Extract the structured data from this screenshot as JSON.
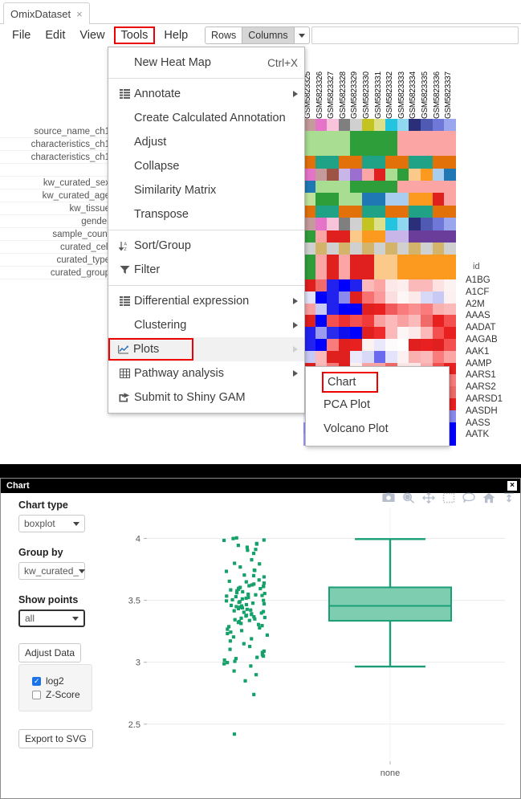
{
  "window": {
    "tab_title": "OmixDataset",
    "tab_close": "×"
  },
  "menubar": {
    "items": [
      {
        "label": "File",
        "highlighted": false
      },
      {
        "label": "Edit",
        "highlighted": false
      },
      {
        "label": "View",
        "highlighted": false
      },
      {
        "label": "Tools",
        "highlighted": true
      },
      {
        "label": "Help",
        "highlighted": false
      }
    ],
    "rows_label": "Rows",
    "columns_label": "Columns",
    "search_value": ""
  },
  "tools_menu": {
    "groups": [
      {
        "items": [
          {
            "label": "New Heat Map",
            "shortcut": "Ctrl+X",
            "icon": "",
            "submenu": false
          }
        ]
      },
      {
        "items": [
          {
            "label": "Annotate",
            "shortcut": "",
            "icon": "list-icon",
            "submenu": true
          },
          {
            "label": "Create Calculated Annotation",
            "shortcut": "",
            "icon": "",
            "submenu": false
          },
          {
            "label": "Adjust",
            "shortcut": "",
            "icon": "",
            "submenu": false
          },
          {
            "label": "Collapse",
            "shortcut": "",
            "icon": "",
            "submenu": false
          },
          {
            "label": "Similarity Matrix",
            "shortcut": "",
            "icon": "",
            "submenu": false
          },
          {
            "label": "Transpose",
            "shortcut": "",
            "icon": "",
            "submenu": false
          }
        ]
      },
      {
        "items": [
          {
            "label": "Sort/Group",
            "shortcut": "",
            "icon": "sort-az-icon",
            "submenu": false
          },
          {
            "label": "Filter",
            "shortcut": "",
            "icon": "funnel-icon",
            "submenu": false
          }
        ]
      },
      {
        "items": [
          {
            "label": "Differential expression",
            "shortcut": "",
            "icon": "list-icon",
            "submenu": true
          },
          {
            "label": "Clustering",
            "shortcut": "",
            "icon": "",
            "submenu": true
          },
          {
            "label": "Plots",
            "shortcut": "",
            "icon": "chart-line-icon",
            "submenu": true,
            "highlighted": true
          },
          {
            "label": "Pathway analysis",
            "shortcut": "",
            "icon": "table-icon",
            "submenu": true
          },
          {
            "label": "Submit to Shiny GAM",
            "shortcut": "",
            "icon": "share-icon",
            "submenu": false
          }
        ]
      }
    ]
  },
  "plots_submenu": {
    "items": [
      {
        "label": "Chart",
        "highlighted": true
      },
      {
        "label": "PCA Plot",
        "highlighted": false
      },
      {
        "label": "Volcano Plot",
        "highlighted": false
      }
    ]
  },
  "heatmap": {
    "row_labels": [
      "source_name_ch1",
      "characteristics_ch1",
      "characteristics_ch1",
      "",
      "kw_curated_sex",
      "kw_curated_age",
      "kw_tissue",
      "gender",
      "sample_count",
      "curated_cell",
      "curated_type",
      "curated_group"
    ],
    "column_headers": [
      "GSM5823325",
      "GSM5823326",
      "GSM5823327",
      "GSM5823328",
      "GSM5823329",
      "GSM5823330",
      "GSM5823331",
      "GSM5823332",
      "GSM5823333",
      "GSM5823334",
      "GSM5823335",
      "GSM5823336",
      "GSM5823337"
    ],
    "id_header": "id",
    "gene_ids": [
      "A1BG",
      "A1CF",
      "A2M",
      "AAAS",
      "AADAT",
      "AAGAB",
      "AAK1",
      "AAMP",
      "AARS1",
      "AARS2",
      "AARSD1",
      "AASDH",
      "AASS",
      "AATK"
    ],
    "annotation_rows": [
      [
        "#c49a9a",
        "#e573c7",
        "#f9c4db",
        "#7f7f7f",
        "#d0d0d0",
        "#c3c421",
        "#dde08a",
        "#22c4e0",
        "#8fd8ef",
        "#2b2f7a",
        "#4f5bb3",
        "#6f78d8",
        "#9aa6ee"
      ],
      [
        "#a8dd92",
        "#a8dd92",
        "#a8dd92",
        "#a8dd92",
        "#2e9e3a",
        "#2e9e3a",
        "#2e9e3a",
        "#2e9e3a",
        "#fba5a5",
        "#fba5a5",
        "#fba5a5",
        "#fba5a5",
        "#fba5a5"
      ],
      [
        "#a8dd92",
        "#a8dd92",
        "#a8dd92",
        "#a8dd92",
        "#2e9e3a",
        "#2e9e3a",
        "#2e9e3a",
        "#2e9e3a",
        "#fba5a5",
        "#fba5a5",
        "#fba5a5",
        "#fba5a5",
        "#fba5a5"
      ],
      [
        "#e2710a",
        "#20a286",
        "#20a286",
        "#e2710a",
        "#e2710a",
        "#20a286",
        "#20a286",
        "#e2710a",
        "#e2710a",
        "#20a286",
        "#20a286",
        "#e2710a",
        "#e2710a"
      ],
      [
        "#e573c7",
        "#c49a9a",
        "#9d5444",
        "#c9b6e8",
        "#9b6fcf",
        "#fba5a5",
        "#e01f1f",
        "#a8dd92",
        "#2e9e3a",
        "#fbc98a",
        "#fb9a1e",
        "#a9cdef",
        "#1f78b4"
      ],
      [
        "#1f78b4",
        "#a8dd92",
        "#a8dd92",
        "#a8dd92",
        "#2e9e3a",
        "#2e9e3a",
        "#2e9e3a",
        "#2e9e3a",
        "#fba5a5",
        "#fba5a5",
        "#fba5a5",
        "#fba5a5",
        "#fba5a5"
      ],
      [
        "#bfe39d",
        "#2e9e3a",
        "#2e9e3a",
        "#a8dd92",
        "#a8dd92",
        "#1f78b4",
        "#1f78b4",
        "#a9cdef",
        "#a9cdef",
        "#fb9a1e",
        "#fb9a1e",
        "#e01f1f",
        "#fba5a5"
      ],
      [
        "#e2710a",
        "#20a286",
        "#20a286",
        "#e2710a",
        "#e2710a",
        "#20a286",
        "#20a286",
        "#e2710a",
        "#e2710a",
        "#20a286",
        "#20a286",
        "#e2710a",
        "#e2710a"
      ],
      [
        "#c49a9a",
        "#e573c7",
        "#f9c4db",
        "#7f7f7f",
        "#d0d0d0",
        "#c3c421",
        "#dde08a",
        "#22c4e0",
        "#8fd8ef",
        "#2b2f7a",
        "#4f5bb3",
        "#6f78d8",
        "#9aa6ee"
      ],
      [
        "#2e9e3a",
        "#fba5a5",
        "#e01f1f",
        "#e01f1f",
        "#fbc98a",
        "#fb9a1e",
        "#fb9a1e",
        "#c9b6e8",
        "#c9b6e8",
        "#6a3d9a",
        "#6a3d9a",
        "#6a3d9a",
        "#6a3d9a"
      ],
      [
        "#d0d0d0",
        "#d4b46a",
        "#d0d0d0",
        "#d4b46a",
        "#d0d0d0",
        "#d4b46a",
        "#d0d0d0",
        "#d4b46a",
        "#d0d0d0",
        "#d4b46a",
        "#d0d0d0",
        "#d4b46a",
        "#d0d0d0"
      ],
      [
        "#2e9e3a",
        "#fba5a5",
        "#e01f1f",
        "#fba5a5",
        "#e01f1f",
        "#e01f1f",
        "#fbc98a",
        "#fbc98a",
        "#fb9a1e",
        "#fb9a1e",
        "#fb9a1e",
        "#fb9a1e",
        "#fb9a1e"
      ],
      [
        "#2e9e3a",
        "#fba5a5",
        "#e01f1f",
        "#fba5a5",
        "#e01f1f",
        "#e01f1f",
        "#fbc98a",
        "#fbc98a",
        "#fb9a1e",
        "#fb9a1e",
        "#fb9a1e",
        "#fb9a1e",
        "#fb9a1e"
      ]
    ],
    "expression_rows": [
      [
        "#e01f1f",
        "#f06a6a",
        "#2222ee",
        "#0000ff",
        "#2222ee",
        "#fbb9b9",
        "#fba5a5",
        "#fde8e8",
        "#fdeeee",
        "#fbb9b9",
        "#fbb9b9",
        "#fde2e2",
        "#fdf2f2"
      ],
      [
        "#e3e3fb",
        "#0000ff",
        "#2222ee",
        "#8a8aee",
        "#e01f1f",
        "#f97070",
        "#fb9a9a",
        "#fcdede",
        "#fdf6f6",
        "#fceaea",
        "#d8d8f7",
        "#c9c9f5",
        "#fdf0f0"
      ],
      [
        "#f9a0a0",
        "#c9c9f5",
        "#2222ee",
        "#0000ff",
        "#0000ff",
        "#e01f1f",
        "#e82020",
        "#f05a5a",
        "#f97b7b",
        "#f98f8f",
        "#f97b7b",
        "#fbb0b0",
        "#fbb9b9"
      ],
      [
        "#e01f1f",
        "#0000ff",
        "#f45050",
        "#ef3030",
        "#f45050",
        "#f13b3b",
        "#f9a0a0",
        "#fbb9b9",
        "#f9a0a0",
        "#fbb9b9",
        "#f06a6a",
        "#e82020",
        "#f45050"
      ],
      [
        "#2222ee",
        "#9a9af0",
        "#2b2bee",
        "#1010ee",
        "#0000ff",
        "#e01f1f",
        "#ee2a2a",
        "#fbb9b9",
        "#fdf6f6",
        "#fceaea",
        "#fbb9b9",
        "#f45050",
        "#e82020"
      ],
      [
        "#2222ee",
        "#0000ff",
        "#f97b7b",
        "#e01f1f",
        "#e82020",
        "#fdf2f2",
        "#e9e9fb",
        "#fdfbfb",
        "#ffffff",
        "#e01f1f",
        "#e82020",
        "#e01f1f",
        "#f45050"
      ],
      [
        "#c9c9f5",
        "#fbb9b9",
        "#e01f1f",
        "#e01f1f",
        "#e9e9fb",
        "#d8d8f7",
        "#6a6aef",
        "#e3e3fb",
        "#fdf0f0",
        "#fbb0b0",
        "#fbb9b9",
        "#f97b7b",
        "#fba5a5"
      ],
      [
        "#e01f1f",
        "#fbb9b9",
        "#f97b7b",
        "#e01f1f",
        "#fdf2f2",
        "#fba5a5",
        "#fba5a5",
        "#f06a6a",
        "#fde8e8",
        "#fceaea",
        "#fbb0b0",
        "#f45050",
        "#e82020"
      ],
      [
        "#8a8aee",
        "#c9c9f5",
        "#e3e3fb",
        "#f9a0a0",
        "#fbb9b9",
        "#e01f1f",
        "#f45050",
        "#fbb0b0",
        "#fdeeee",
        "#d8d8f7",
        "#c9c9f5",
        "#fba5a5",
        "#f97b7b"
      ],
      [
        "#b5b5f2",
        "#9a9af0",
        "#e9e9fb",
        "#fdf2f2",
        "#e01f1f",
        "#f45050",
        "#fba5a5",
        "#fdf0f0",
        "#c9c9f5",
        "#b5b5f2",
        "#e3e3fb",
        "#fbb9b9",
        "#f06a6a"
      ],
      [
        "#6a6aef",
        "#2222ee",
        "#8a8aee",
        "#fbb9b9",
        "#e01f1f",
        "#f97b7b",
        "#fdeeee",
        "#fceaea",
        "#fdf6f6",
        "#e3e3fb",
        "#fba5a5",
        "#f45050",
        "#e82020"
      ],
      [
        "#e3e3fb",
        "#fbb0b0",
        "#f06a6a",
        "#e01f1f",
        "#e82020",
        "#f9a0a0",
        "#fde8e8",
        "#ffffff",
        "#fdf6f6",
        "#c9c9f5",
        "#b5b5f2",
        "#9a9af0",
        "#8a8aee"
      ],
      [
        "#8a8aee",
        "#6a6aef",
        "#e3e3fb",
        "#fdf2f2",
        "#fba5a5",
        "#e01f1f",
        "#f45050",
        "#fbb9b9",
        "#fdeeee",
        "#fceaea",
        "#e9e9fb",
        "#2222ee",
        "#0000ff"
      ],
      [
        "#9a9af0",
        "#b5b5f2",
        "#e9e9fb",
        "#fceaea",
        "#fbb0b0",
        "#e01f1f",
        "#f97b7b",
        "#fba5a5",
        "#c9c9f5",
        "#d8d8f7",
        "#e3e3fb",
        "#2222ee",
        "#0000ff"
      ]
    ]
  },
  "chart_panel": {
    "title": "Chart",
    "close_label": "×",
    "controls": {
      "chart_type_label": "Chart type",
      "chart_type_value": "boxplot",
      "group_by_label": "Group by",
      "group_by_value": "kw_curated_",
      "show_points_label": "Show points",
      "show_points_value": "all",
      "adjust_data_label": "Adjust Data",
      "checkboxes": [
        {
          "label": "log2",
          "checked": true
        },
        {
          "label": "Z-Score",
          "checked": false
        }
      ],
      "export_label": "Export to SVG"
    },
    "modebar": [
      "camera-icon",
      "zoom-icon",
      "pan-icon",
      "box-select-icon",
      "lasso-select-icon",
      "home-icon",
      "autoscale-icon"
    ]
  },
  "chart_data": {
    "type": "box",
    "title": "",
    "xlabel": "",
    "ylabel": "",
    "categories": [
      "none"
    ],
    "ylim": [
      2.2,
      4.25
    ],
    "yticks": [
      2.5,
      3,
      3.5,
      4
    ],
    "ytick_labels": [
      "2.5",
      "3",
      "3.5",
      "4"
    ],
    "grid": true,
    "legend": "none",
    "box_color": "#7fcdb0",
    "box_line_color": "#1b9e77",
    "point_color": "#16a06a",
    "series": [
      {
        "name": "none",
        "box": {
          "lower_whisker": 2.965,
          "q1": 3.335,
          "median": 3.455,
          "q3": 3.605,
          "upper_whisker": 3.995
        },
        "points": [
          3.985,
          3.988,
          4.005,
          4.0,
          3.912,
          3.93,
          3.945,
          3.96,
          3.955,
          3.905,
          3.88,
          3.828,
          3.795,
          3.8,
          3.77,
          3.742,
          3.745,
          3.735,
          3.7,
          3.705,
          3.69,
          3.665,
          3.655,
          3.65,
          3.64,
          3.632,
          3.625,
          3.618,
          3.615,
          3.612,
          3.605,
          3.598,
          3.595,
          3.59,
          3.585,
          3.578,
          3.57,
          3.562,
          3.556,
          3.55,
          3.545,
          3.54,
          3.535,
          3.53,
          3.524,
          3.518,
          3.512,
          3.505,
          3.5,
          3.496,
          3.49,
          3.484,
          3.478,
          3.472,
          3.466,
          3.46,
          3.455,
          3.45,
          3.445,
          3.44,
          3.434,
          3.428,
          3.422,
          3.416,
          3.41,
          3.404,
          3.398,
          3.392,
          3.386,
          3.38,
          3.374,
          3.368,
          3.362,
          3.356,
          3.35,
          3.344,
          3.338,
          3.33,
          3.322,
          3.314,
          3.305,
          3.296,
          3.288,
          3.278,
          3.268,
          3.256,
          3.244,
          3.232,
          3.22,
          3.205,
          3.19,
          3.172,
          3.15,
          3.128,
          3.105,
          3.09,
          3.08,
          3.07,
          3.06,
          3.05,
          3.04,
          3.03,
          3.018,
          3.008,
          2.998,
          2.988,
          2.97,
          2.93,
          2.9,
          2.85,
          2.74,
          2.42
        ]
      }
    ]
  }
}
